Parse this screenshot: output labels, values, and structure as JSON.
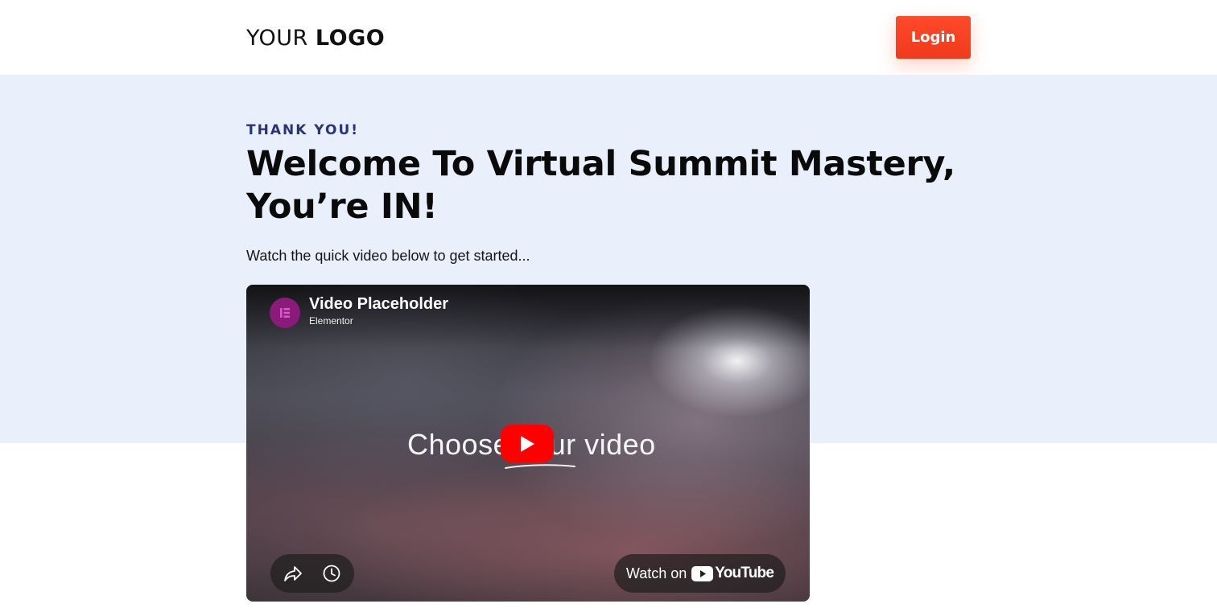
{
  "header": {
    "logo_light": "YOUR ",
    "logo_bold": "LOGO",
    "login_label": "Login"
  },
  "hero": {
    "eyebrow": "THANK YOU!",
    "headline": "Welcome To Virtual Summit Mastery, You’re IN!",
    "subtext": "Watch the quick video below to get started..."
  },
  "video": {
    "title": "Video Placeholder",
    "channel": "Elementor",
    "overlay_text": "Choose your video",
    "watch_on_label": "Watch on",
    "youtube_wordmark": "YouTube",
    "icons": [
      "elementor-icon",
      "play-icon",
      "share-icon",
      "clock-icon",
      "youtube-icon"
    ]
  },
  "colors": {
    "accent": "#ef3a1b",
    "hero_bg": "#e9f0fb",
    "eyebrow": "#2a3478",
    "youtube_red": "#ff0000"
  }
}
